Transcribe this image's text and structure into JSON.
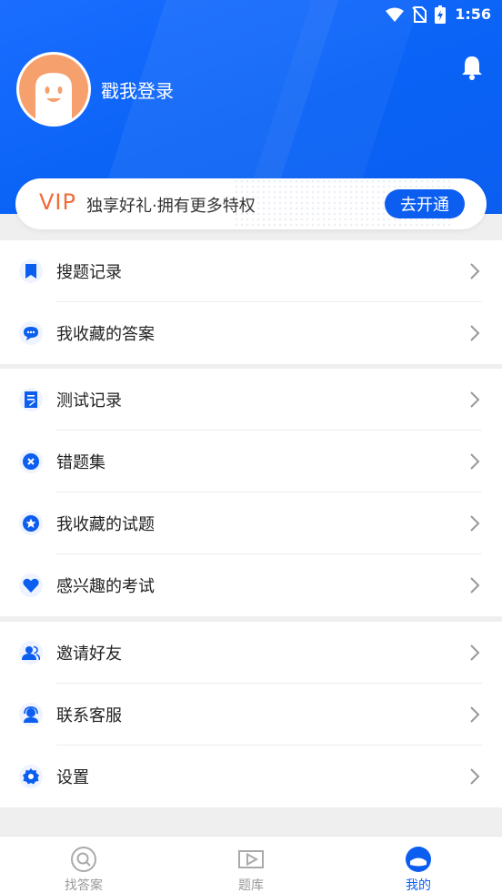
{
  "status": {
    "time": "1:56",
    "icons": [
      "wifi-icon",
      "no-sim-icon",
      "battery-charging-icon"
    ]
  },
  "header": {
    "login_text": "戳我登录",
    "bell_icon": "bell-icon"
  },
  "vip": {
    "label": "VIP",
    "description": "独享好礼·拥有更多特权",
    "button": "去开通"
  },
  "groups": [
    {
      "items": [
        {
          "label": "搜题记录",
          "icon": "bookmark-icon"
        },
        {
          "label": "我收藏的答案",
          "icon": "chat-bubble-icon"
        }
      ]
    },
    {
      "items": [
        {
          "label": "测试记录",
          "icon": "document-edit-icon"
        },
        {
          "label": "错题集",
          "icon": "close-circle-icon"
        },
        {
          "label": "我收藏的试题",
          "icon": "star-icon"
        },
        {
          "label": "感兴趣的考试",
          "icon": "heart-icon"
        }
      ]
    },
    {
      "items": [
        {
          "label": "邀请好友",
          "icon": "users-icon"
        },
        {
          "label": "联系客服",
          "icon": "customer-service-icon"
        },
        {
          "label": "设置",
          "icon": "gear-icon"
        }
      ]
    }
  ],
  "bottom_nav": {
    "tabs": [
      {
        "label": "找答案",
        "icon": "search-icon",
        "active": false
      },
      {
        "label": "题库",
        "icon": "play-icon",
        "active": false
      },
      {
        "label": "我的",
        "icon": "profile-icon",
        "active": true
      }
    ]
  },
  "colors": {
    "primary": "#0b5ef0",
    "vip": "#ef6b3a",
    "background": "#efefef"
  }
}
